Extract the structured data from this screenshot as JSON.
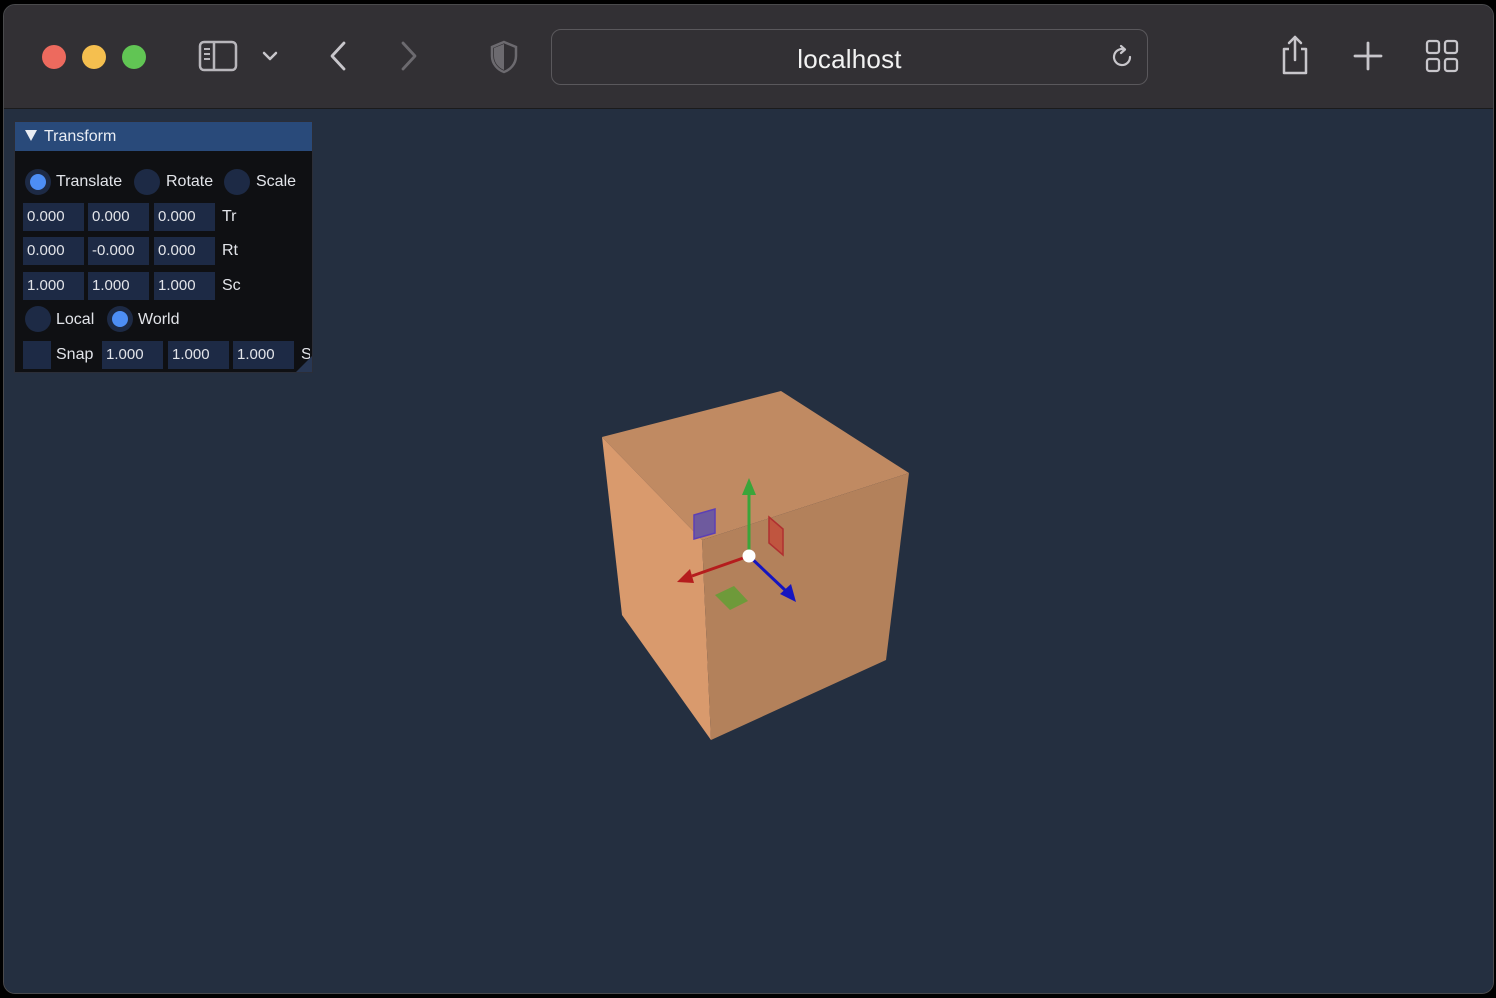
{
  "browser": {
    "url": "localhost"
  },
  "panel": {
    "title": "Transform",
    "modes": [
      {
        "label": "Translate",
        "selected": true
      },
      {
        "label": "Rotate",
        "selected": false
      },
      {
        "label": "Scale",
        "selected": false
      }
    ],
    "rows": [
      {
        "values": [
          "0.000",
          "0.000",
          "0.000"
        ],
        "label": "Tr"
      },
      {
        "values": [
          "0.000",
          "-0.000",
          "0.000"
        ],
        "label": "Rt"
      },
      {
        "values": [
          "1.000",
          "1.000",
          "1.000"
        ],
        "label": "Sc"
      }
    ],
    "space": [
      {
        "label": "Local",
        "selected": false
      },
      {
        "label": "World",
        "selected": true
      }
    ],
    "snap": {
      "label": "Snap",
      "checked": false,
      "values": [
        "1.000",
        "1.000",
        "1.000"
      ],
      "trailing": "S"
    }
  },
  "scene": {
    "cube_color": "#d49468",
    "gizmo": {
      "x_axis": "#b51d1d",
      "y_axis": "#3aa53a",
      "z_axis": "#1515c0"
    }
  }
}
